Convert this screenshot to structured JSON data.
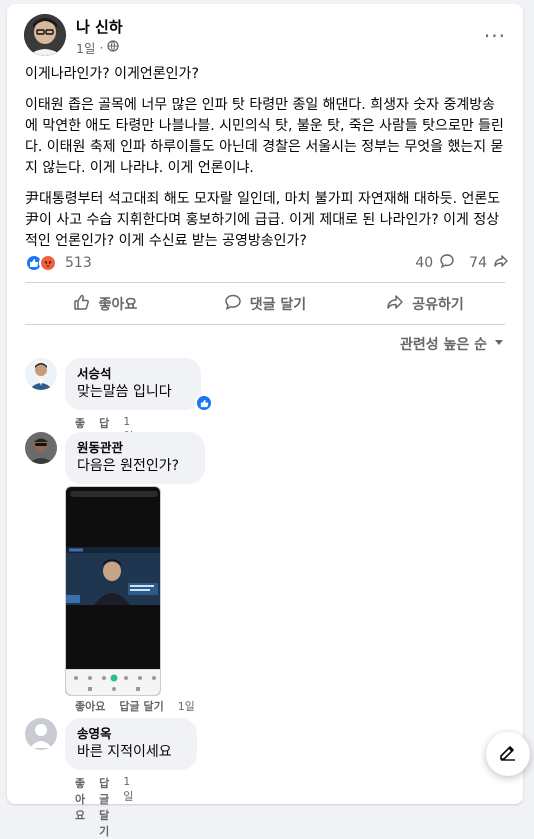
{
  "post": {
    "author": "나 신하",
    "time": "1일",
    "more_label": "···",
    "paragraphs": [
      "이게나라인가? 이게언론인가?",
      "이태원 좁은 골목에 너무 많은 인파 탓 타령만 종일 해댄다. 희생자 숫자 중계방송에 막연한 애도 타령만 나블나블. 시민의식 탓, 불운 탓, 죽은 사람들 탓으로만 들린다. 이태원 축제 인파 하루이틀도 아닌데 경찰은 서울시는 정부는 무엇을 했는지 묻지 않는다. 이게 나라냐. 이게 언론이냐.",
      "尹대통령부터 석고대죄 해도 모자랄   일인데, 마치 불가피 자연재해 대하듯. 언론도 尹이 사고 수습 지휘한다며 홍보하기에 급급. 이게 제대로 된 나라인가? 이게 정상적인 언론인가? 이게 수신료 받는 공영방송인가?"
    ],
    "reaction_count": "513",
    "comment_count": "40",
    "share_count": "74"
  },
  "actions": {
    "like": "좋아요",
    "comment": "댓글 달기",
    "share": "공유하기"
  },
  "sort_label": "관련성 높은 순",
  "comments": [
    {
      "name": "서승석",
      "text": "맞는말씀 입니다",
      "like": "좋아요",
      "reply": "답글 달기",
      "time": "1일"
    },
    {
      "name": "원동관관",
      "text": "다음은 원전인가?",
      "like": "좋아요",
      "reply": "답글 달기",
      "time": "1일"
    },
    {
      "name": "송영옥",
      "text": "바른 지적이세요",
      "like": "좋아요",
      "reply": "답글 달기",
      "time": "1일"
    }
  ],
  "colors": {
    "accent": "#1877f2",
    "angry": "#f0603e",
    "muted": "#65676b"
  }
}
